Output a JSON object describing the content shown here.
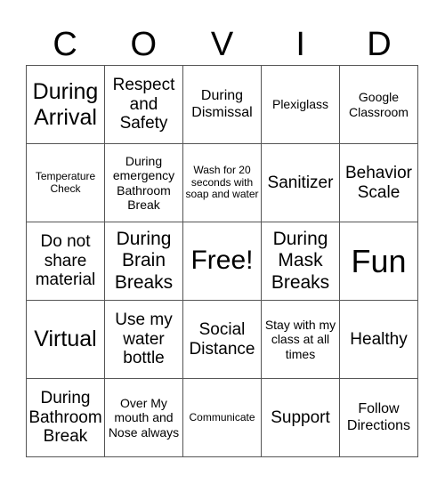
{
  "title_letters": [
    "C",
    "O",
    "V",
    "I",
    "D"
  ],
  "cells": [
    "During Arrival",
    "Respect and Safety",
    "During Dismissal",
    "Plexiglass",
    "Google Classroom",
    "Temperature Check",
    "During emergency Bathroom Break",
    "Wash for 20 seconds with soap and water",
    "Sanitizer",
    "Behavior Scale",
    "Do not share material",
    "During Brain Breaks",
    "Free!",
    "During Mask Breaks",
    "Fun",
    "Virtual",
    "Use my water bottle",
    "Social Distance",
    "Stay with my class at all times",
    "Healthy",
    "During Bathroom Break",
    "Over My mouth and Nose always",
    "Communicate",
    "Support",
    "Follow Directions"
  ]
}
